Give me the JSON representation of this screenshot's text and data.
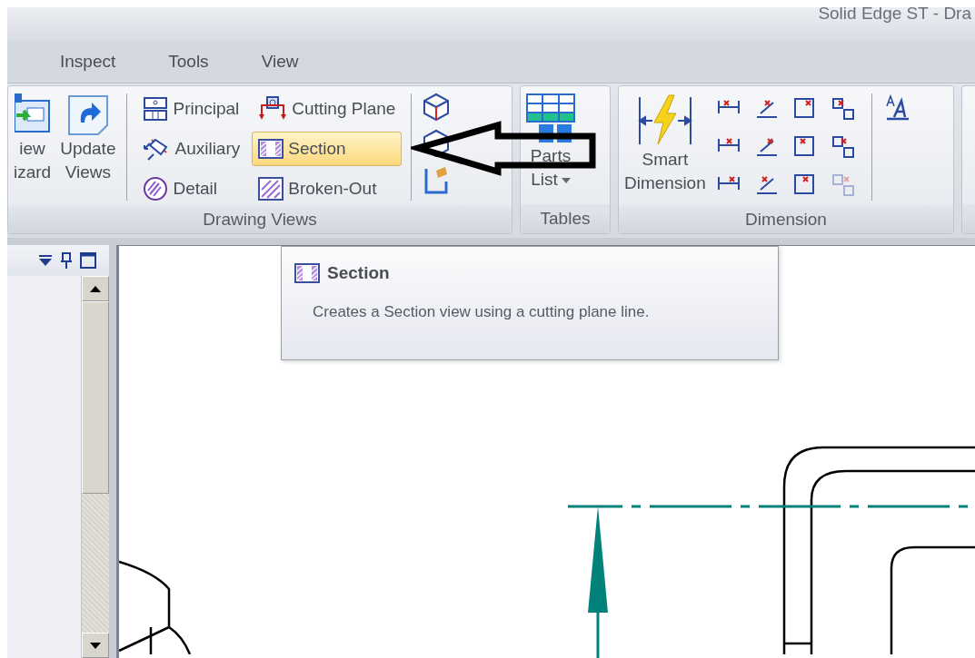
{
  "window": {
    "title": "Solid Edge ST - Dra"
  },
  "tabs": [
    {
      "label": "Inspect",
      "selected": false
    },
    {
      "label": "Tools",
      "selected": false
    },
    {
      "label": "View",
      "selected": false
    }
  ],
  "ribbon": {
    "groups": [
      {
        "kind": "drawing_views",
        "label": "Drawing Views",
        "large_buttons": [
          {
            "lines": [
              "iew",
              "izard"
            ]
          },
          {
            "lines": [
              "Update",
              "Views"
            ]
          }
        ],
        "commands": [
          {
            "label": "Principal",
            "selected": false
          },
          {
            "label": "Auxiliary",
            "selected": false
          },
          {
            "label": "Detail",
            "selected": false
          },
          {
            "label": "Cutting Plane",
            "selected": false
          },
          {
            "label": "Section",
            "selected": true
          },
          {
            "label": "Broken-Out",
            "selected": false
          }
        ]
      },
      {
        "kind": "tables",
        "label": "Tables",
        "large_buttons": [
          {
            "lines": [
              "Parts",
              "List"
            ]
          }
        ]
      },
      {
        "kind": "dimension",
        "label": "Dimension",
        "large_buttons": [
          {
            "lines": [
              "Smart",
              "Dimension"
            ]
          }
        ],
        "tools": [
          {
            "disabled": false
          },
          {
            "disabled": false
          },
          {
            "disabled": false
          },
          {
            "disabled": false
          },
          {
            "disabled": false
          },
          {
            "disabled": false
          },
          {
            "disabled": false
          },
          {
            "disabled": false
          },
          {
            "disabled": false
          },
          {
            "disabled": false
          },
          {
            "disabled": false
          },
          {
            "disabled": true
          }
        ]
      }
    ]
  },
  "tooltip": {
    "title": "Section",
    "description": "Creates a Section view using a cutting plane line."
  }
}
